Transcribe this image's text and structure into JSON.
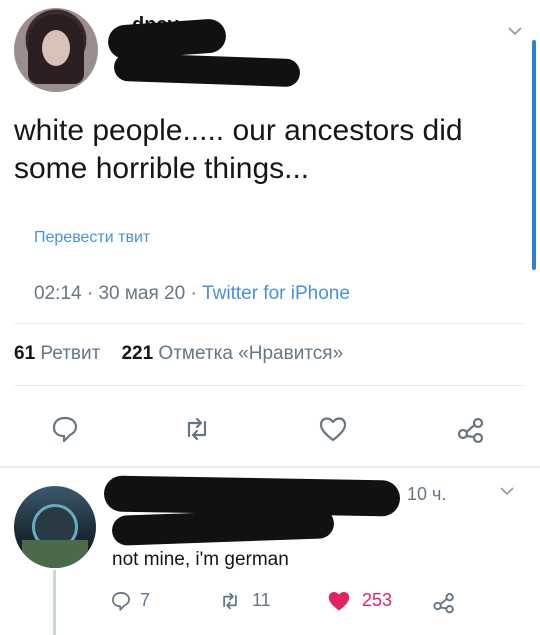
{
  "tweet": {
    "author_name_partial": "dney",
    "text": "white people..... our ancestors did some horrible things...",
    "translate_label": "Перевести твит",
    "time": "02:14",
    "sep1": "·",
    "date": "30 мая 20",
    "sep2": "·",
    "source": "Twitter for iPhone",
    "retweets_count": "61",
    "retweets_label": "Ретвит",
    "likes_count": "221",
    "likes_label": "Отметка «Нравится»"
  },
  "reply": {
    "time": "10 ч.",
    "text": "not mine, i'm german",
    "reply_count": "7",
    "retweet_count": "11",
    "like_count": "253"
  },
  "colors": {
    "link": "#4a90d9",
    "muted": "#657786",
    "like_red": "#e0245e"
  },
  "icons": {
    "reply": "comment-icon",
    "retweet": "retweet-icon",
    "like": "heart-icon",
    "share": "share-icon",
    "more": "chevron-down-icon"
  }
}
